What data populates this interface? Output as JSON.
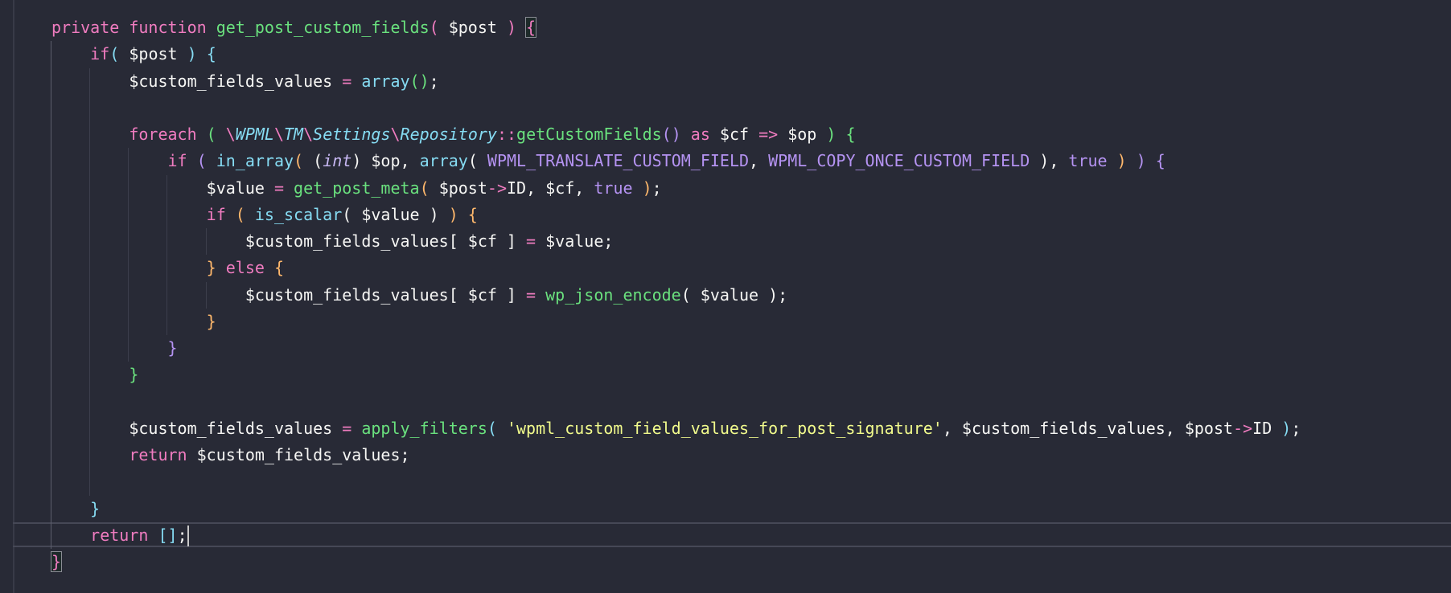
{
  "editor": {
    "theme_colors": {
      "background": "#282a36",
      "keyword": "#f07cc0",
      "function": "#6ae17e",
      "builtin": "#86dcf3",
      "constant": "#b593f2",
      "bracket": "#ffb86c",
      "string": "#f1fa8c"
    },
    "current_line": 19,
    "lines": [
      [
        [
          "private function ",
          "k"
        ],
        [
          "get_post_custom_fields",
          "f"
        ],
        [
          "( ",
          "k"
        ],
        [
          "$post ",
          "w"
        ],
        [
          ") ",
          "k"
        ],
        [
          "{",
          "k bm"
        ]
      ],
      [
        [
          "    ",
          ""
        ],
        [
          "if",
          "k"
        ],
        [
          "( ",
          "c"
        ],
        [
          "$post ",
          "w"
        ],
        [
          ") {",
          "c"
        ]
      ],
      [
        [
          "        ",
          ""
        ],
        [
          "$custom_fields_values ",
          "w"
        ],
        [
          "= ",
          "k"
        ],
        [
          "array",
          "c"
        ],
        [
          "()",
          "f"
        ],
        [
          ";",
          "w"
        ]
      ],
      [],
      [
        [
          "        ",
          ""
        ],
        [
          "foreach ",
          "k"
        ],
        [
          "( ",
          "f"
        ],
        [
          "\\",
          "k"
        ],
        [
          "WPML",
          "ci"
        ],
        [
          "\\",
          "k"
        ],
        [
          "TM",
          "ci"
        ],
        [
          "\\",
          "k"
        ],
        [
          "Settings",
          "ci"
        ],
        [
          "\\",
          "k"
        ],
        [
          "Repository",
          "ci"
        ],
        [
          "::",
          "k"
        ],
        [
          "getCustomFields",
          "f"
        ],
        [
          "() ",
          "p"
        ],
        [
          "as ",
          "k"
        ],
        [
          "$cf ",
          "w"
        ],
        [
          "=> ",
          "k"
        ],
        [
          "$op ",
          "w"
        ],
        [
          ") {",
          "f"
        ]
      ],
      [
        [
          "            ",
          ""
        ],
        [
          "if ",
          "k"
        ],
        [
          "( ",
          "p"
        ],
        [
          "in_array",
          "c"
        ],
        [
          "( ",
          "o"
        ],
        [
          "(",
          "w"
        ],
        [
          "int",
          "pi"
        ],
        [
          ") $op, ",
          "w"
        ],
        [
          "array",
          "c"
        ],
        [
          "( ",
          "w"
        ],
        [
          "WPML_TRANSLATE_CUSTOM_FIELD",
          "p"
        ],
        [
          ", ",
          "w"
        ],
        [
          "WPML_COPY_ONCE_CUSTOM_FIELD ",
          "p"
        ],
        [
          "), ",
          "w"
        ],
        [
          "true ",
          "p"
        ],
        [
          ") ",
          "o"
        ],
        [
          ") {",
          "p"
        ]
      ],
      [
        [
          "                ",
          ""
        ],
        [
          "$value ",
          "w"
        ],
        [
          "= ",
          "k"
        ],
        [
          "get_post_meta",
          "f"
        ],
        [
          "( ",
          "o"
        ],
        [
          "$post",
          "w"
        ],
        [
          "->",
          "k"
        ],
        [
          "ID, $cf, ",
          "w"
        ],
        [
          "true ",
          "p"
        ],
        [
          ")",
          "o"
        ],
        [
          ";",
          "w"
        ]
      ],
      [
        [
          "                ",
          ""
        ],
        [
          "if ",
          "k"
        ],
        [
          "( ",
          "o"
        ],
        [
          "is_scalar",
          "c"
        ],
        [
          "( $value ) ",
          "w"
        ],
        [
          ") {",
          "o"
        ]
      ],
      [
        [
          "                    ",
          ""
        ],
        [
          "$custom_fields_values[ $cf ] ",
          "w"
        ],
        [
          "= ",
          "k"
        ],
        [
          "$value;",
          "w"
        ]
      ],
      [
        [
          "                ",
          ""
        ],
        [
          "} ",
          "o"
        ],
        [
          "else ",
          "k"
        ],
        [
          "{",
          "o"
        ]
      ],
      [
        [
          "                    ",
          ""
        ],
        [
          "$custom_fields_values[ $cf ] ",
          "w"
        ],
        [
          "= ",
          "k"
        ],
        [
          "wp_json_encode",
          "f"
        ],
        [
          "( $value );",
          "w"
        ]
      ],
      [
        [
          "                ",
          ""
        ],
        [
          "}",
          "o"
        ]
      ],
      [
        [
          "            ",
          ""
        ],
        [
          "}",
          "p"
        ]
      ],
      [
        [
          "        ",
          ""
        ],
        [
          "}",
          "f"
        ]
      ],
      [],
      [
        [
          "        ",
          ""
        ],
        [
          "$custom_fields_values ",
          "w"
        ],
        [
          "= ",
          "k"
        ],
        [
          "apply_filters",
          "f"
        ],
        [
          "( ",
          "c"
        ],
        [
          "'wpml_custom_field_values_for_post_signature'",
          "y"
        ],
        [
          ", $custom_fields_values, $post",
          "w"
        ],
        [
          "->",
          "k"
        ],
        [
          "ID ",
          "w"
        ],
        [
          ")",
          "c"
        ],
        [
          ";",
          "w"
        ]
      ],
      [
        [
          "        ",
          ""
        ],
        [
          "return ",
          "k"
        ],
        [
          "$custom_fields_values;",
          "w"
        ]
      ],
      [],
      [
        [
          "    ",
          ""
        ],
        [
          "}",
          "c"
        ]
      ],
      [
        [
          "    ",
          ""
        ],
        [
          "return ",
          "k"
        ],
        [
          "[]",
          "c"
        ],
        [
          ";",
          "w"
        ]
      ],
      [
        [
          "}",
          "k bm"
        ]
      ]
    ]
  }
}
